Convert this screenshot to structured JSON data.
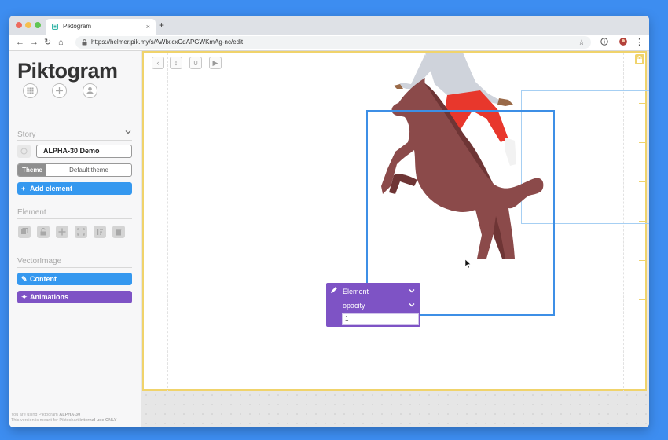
{
  "browser": {
    "tab_title": "Piktogram",
    "tab_close": "×",
    "new_tab": "+",
    "url": "https://helmer.pik.my/s/AWIxlcxCdAPGWKmAg-nc/edit",
    "star": "☆",
    "back": "←",
    "forward": "→",
    "reload": "↻",
    "home": "⌂",
    "menu": "⋮"
  },
  "sidebar": {
    "logo": "Piktogram",
    "top_icons": [
      "grid-icon",
      "plus-icon",
      "user-icon"
    ],
    "story": {
      "title": "Story",
      "name_value": "ALPHA-30 Demo",
      "theme_label": "Theme",
      "theme_value": "Default theme",
      "add_element_label": "Add element"
    },
    "element": {
      "title": "Element",
      "tools": [
        "duplicate-icon",
        "unlock-icon",
        "move-icon",
        "fullscreen-icon",
        "sort-icon",
        "trash-icon"
      ]
    },
    "vector_image": {
      "title": "VectorImage",
      "content_label": "Content",
      "animations_label": "Animations"
    },
    "footer": {
      "line1_prefix": "You are using Piktogram ",
      "line1_version": "ALPHA-30",
      "line2_prefix": "This version is meant for Piktochart ",
      "line2_bold": "internal use ONLY"
    }
  },
  "toolbar": {
    "buttons": [
      "back-icon",
      "resize-vertical-icon",
      "magnet-icon",
      "play-icon"
    ]
  },
  "popup": {
    "element_label": "Element",
    "property_label": "opacity",
    "value": "1"
  },
  "colors": {
    "accent_blue": "#3598ef",
    "accent_purple": "#7e53c5",
    "frame_gold": "#f0d36b",
    "horse": "#8b4a4a",
    "horse_shadow": "#6e3535",
    "runner_pants": "#e8372c",
    "runner_shirt": "#cfd3db"
  }
}
